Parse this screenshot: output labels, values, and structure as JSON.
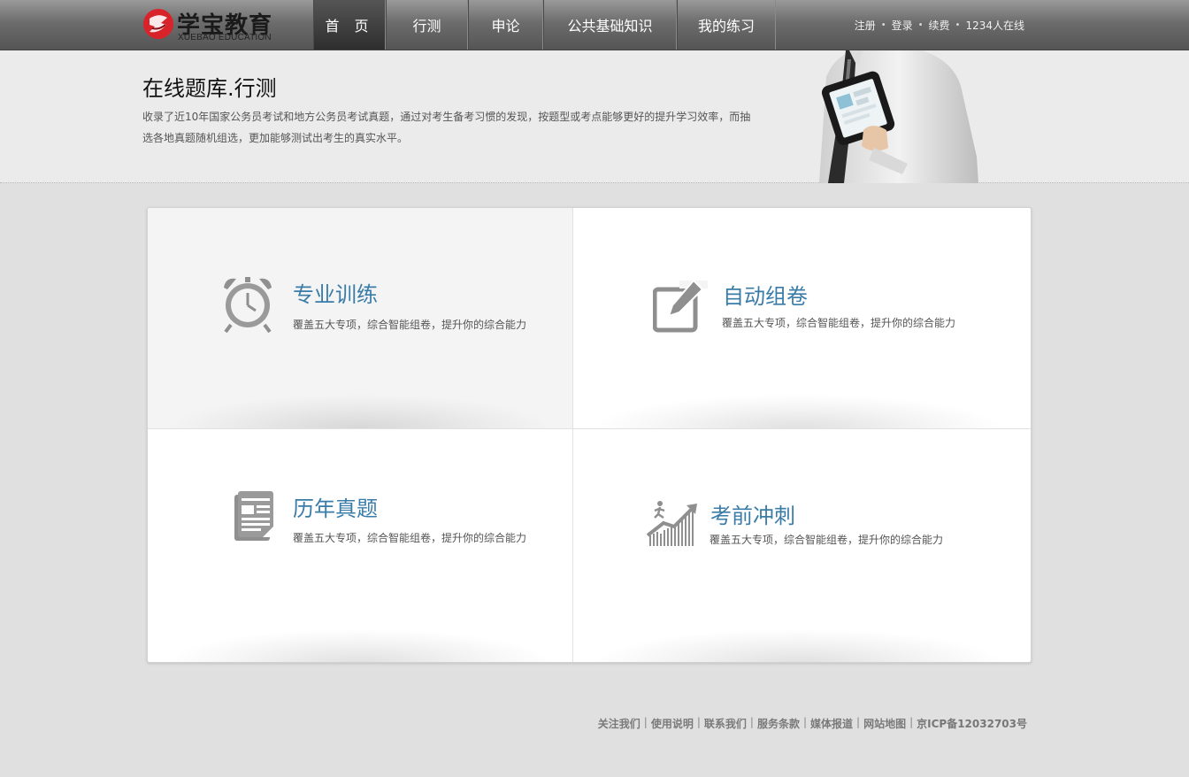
{
  "brand": {
    "name_cn": "学宝教育",
    "name_en": "XUEBAO EDUCATION",
    "logo_color": "#d8232a"
  },
  "nav": {
    "items": [
      {
        "label": "首 页",
        "active": true
      },
      {
        "label": "行测",
        "active": false
      },
      {
        "label": "申论",
        "active": false
      },
      {
        "label": "公共基础知识",
        "active": false
      },
      {
        "label": "我的练习",
        "active": false
      }
    ]
  },
  "user": {
    "register": "注册",
    "login": "登录",
    "renew": "续费",
    "online": "1234人在线"
  },
  "banner": {
    "title": "在线题库.行测",
    "description": "收录了近10年国家公务员考试和地方公务员考试真题，通过对考生备考习惯的发现，按题型或考点能够更好的提升学习效率，而抽选各地真题随机组选，更加能够测试出考生的真实水平。"
  },
  "cards": [
    {
      "title": "专业训练",
      "desc": "覆盖五大专项，综合智能组卷，提升你的综合能力",
      "icon": "alarm-clock-icon"
    },
    {
      "title": "自动组卷",
      "desc": "覆盖五大专项，综合智能组卷，提升你的综合能力",
      "icon": "edit-icon"
    },
    {
      "title": "历年真题",
      "desc": "覆盖五大专项，综合智能组卷，提升你的综合能力",
      "icon": "document-icon"
    },
    {
      "title": "考前冲刺",
      "desc": "覆盖五大专项，综合智能组卷，提升你的综合能力",
      "icon": "sprint-chart-icon"
    }
  ],
  "footer": {
    "links": [
      "关注我们",
      "使用说明",
      "联系我们",
      "服务条款",
      "媒体报道",
      "网站地图"
    ],
    "icp": "京ICP备12032703号"
  },
  "colors": {
    "accent": "#3a7ca8",
    "nav_bg": "#6c6c6c",
    "page_bg": "#e0e0e0"
  }
}
